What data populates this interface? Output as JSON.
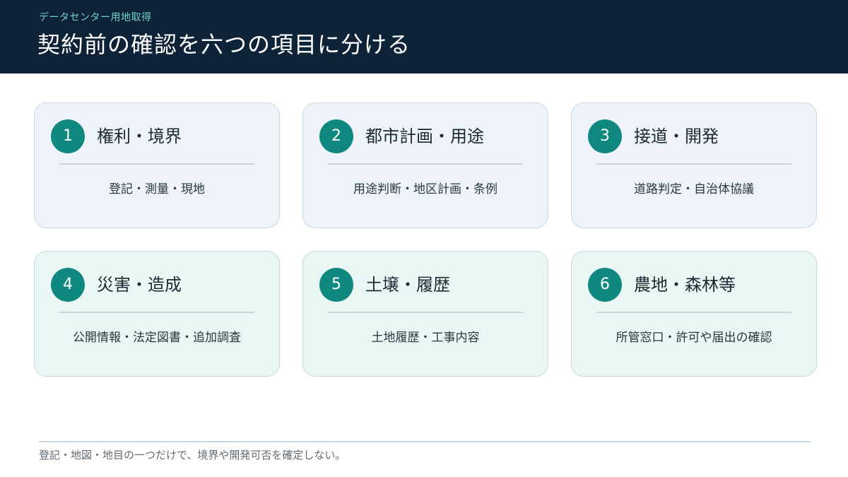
{
  "header": {
    "kicker": "データセンター用地取得",
    "title": "契約前の確認を六つの項目に分ける"
  },
  "cards": [
    {
      "number": "1",
      "title": "権利・境界",
      "description": "登記・測量・現地"
    },
    {
      "number": "2",
      "title": "都市計画・用途",
      "description": "用途判断・地区計画・条例"
    },
    {
      "number": "3",
      "title": "接道・開発",
      "description": "道路判定・自治体協議"
    },
    {
      "number": "4",
      "title": "災害・造成",
      "description": "公開情報・法定図書・追加調査"
    },
    {
      "number": "5",
      "title": "土壌・履歴",
      "description": "土地履歴・工事内容"
    },
    {
      "number": "6",
      "title": "農地・森林等",
      "description": "所管窓口・許可や届出の確認"
    }
  ],
  "footer": {
    "note": "登記・地図・地目の一つだけで、境界や開発可否を確定しない。"
  },
  "colors": {
    "header_bg": "#0e2338",
    "accent": "#0f8880",
    "kicker": "#6fd4c8",
    "card_blue": "#eef3f9",
    "card_green": "#e9f6f3"
  }
}
